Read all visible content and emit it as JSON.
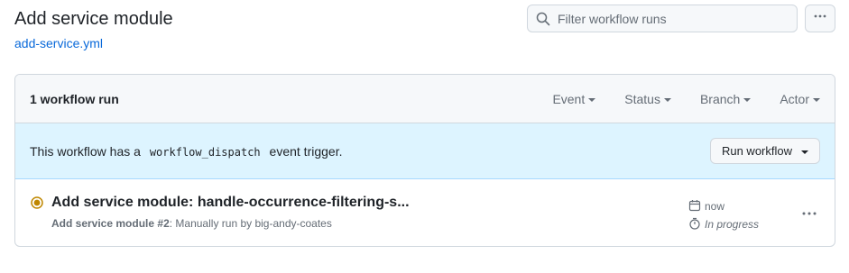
{
  "header": {
    "title": "Add service module",
    "file_link": "add-service.yml",
    "search_placeholder": "Filter workflow runs",
    "icons": {
      "search": "search-icon",
      "more": "kebab-horizontal-icon"
    }
  },
  "runs_box": {
    "count_label": "1 workflow run",
    "filters": [
      {
        "label": "Event"
      },
      {
        "label": "Status"
      },
      {
        "label": "Branch"
      },
      {
        "label": "Actor"
      }
    ]
  },
  "dispatch_banner": {
    "text_before": "This workflow has a",
    "code": "workflow_dispatch",
    "text_after": "event trigger.",
    "button_label": "Run workflow"
  },
  "runs": [
    {
      "title": "Add service module: handle-occurrence-filtering-s...",
      "workflow_name": "Add service module",
      "run_number": "#2",
      "description": ": Manually run by big-andy-coates",
      "time": "now",
      "status": "In progress",
      "status_color": "#bf8700",
      "icons": {
        "status": "in-progress-dot-icon",
        "calendar": "calendar-icon",
        "stopwatch": "stopwatch-icon",
        "more": "kebab-horizontal-icon"
      }
    }
  ],
  "colors": {
    "accent_link": "#0969da",
    "banner_bg": "#ddf4ff",
    "in_progress": "#bf8700"
  }
}
